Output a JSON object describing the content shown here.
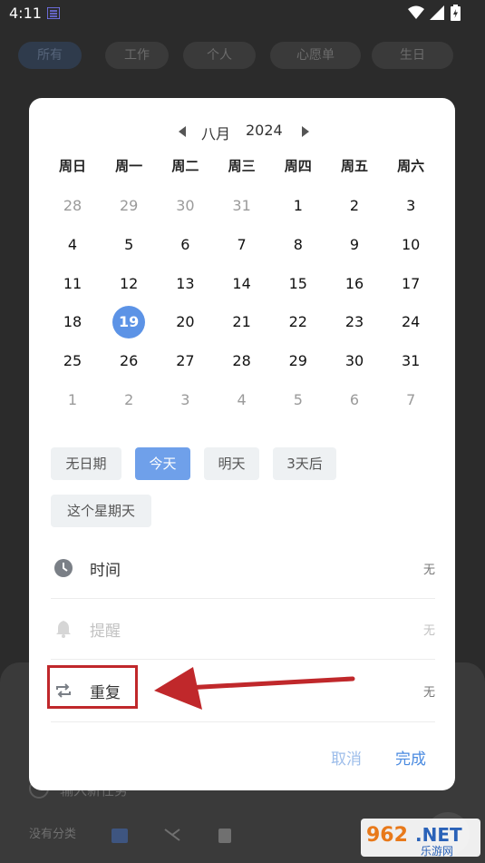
{
  "status_bar": {
    "time": "4:11"
  },
  "background_tabs": [
    {
      "label": "所有",
      "active": true
    },
    {
      "label": "工作",
      "active": false
    },
    {
      "label": "个人",
      "active": false
    },
    {
      "label": "心愿单",
      "active": false
    },
    {
      "label": "生日",
      "active": false
    }
  ],
  "background_sheet": {
    "input_placeholder": "输入新任务",
    "category_label": "没有分类"
  },
  "calendar": {
    "month": "八月",
    "year": "2024",
    "weekdays": [
      "周日",
      "周一",
      "周二",
      "周三",
      "周四",
      "周五",
      "周六"
    ],
    "weeks": [
      [
        {
          "d": "28",
          "m": true
        },
        {
          "d": "29",
          "m": true
        },
        {
          "d": "30",
          "m": true
        },
        {
          "d": "31",
          "m": true
        },
        {
          "d": "1"
        },
        {
          "d": "2"
        },
        {
          "d": "3"
        }
      ],
      [
        {
          "d": "4"
        },
        {
          "d": "5"
        },
        {
          "d": "6"
        },
        {
          "d": "7"
        },
        {
          "d": "8"
        },
        {
          "d": "9"
        },
        {
          "d": "10"
        }
      ],
      [
        {
          "d": "11"
        },
        {
          "d": "12"
        },
        {
          "d": "13"
        },
        {
          "d": "14"
        },
        {
          "d": "15"
        },
        {
          "d": "16"
        },
        {
          "d": "17"
        }
      ],
      [
        {
          "d": "18"
        },
        {
          "d": "19",
          "s": true
        },
        {
          "d": "20"
        },
        {
          "d": "21"
        },
        {
          "d": "22"
        },
        {
          "d": "23"
        },
        {
          "d": "24"
        }
      ],
      [
        {
          "d": "25"
        },
        {
          "d": "26"
        },
        {
          "d": "27"
        },
        {
          "d": "28"
        },
        {
          "d": "29"
        },
        {
          "d": "30"
        },
        {
          "d": "31"
        }
      ],
      [
        {
          "d": "1",
          "m": true
        },
        {
          "d": "2",
          "m": true
        },
        {
          "d": "3",
          "m": true
        },
        {
          "d": "4",
          "m": true
        },
        {
          "d": "5",
          "m": true
        },
        {
          "d": "6",
          "m": true
        },
        {
          "d": "7",
          "m": true
        }
      ]
    ],
    "selected_day": "19"
  },
  "quick_dates": {
    "no_date": "无日期",
    "today": "今天",
    "tomorrow": "明天",
    "three_days": "3天后",
    "this_sunday": "这个星期天"
  },
  "options": {
    "time": {
      "label": "时间",
      "value": "无"
    },
    "reminder": {
      "label": "提醒",
      "value": "无"
    },
    "repeat": {
      "label": "重复",
      "value": "无"
    }
  },
  "actions": {
    "cancel": "取消",
    "done": "完成"
  },
  "colors": {
    "accent": "#5c93e6",
    "annotation": "#c0282b",
    "muted_text": "#9a9a9a"
  },
  "watermark": {
    "prefix": "962",
    "suffix": ".NET",
    "subtitle": "乐游网"
  }
}
